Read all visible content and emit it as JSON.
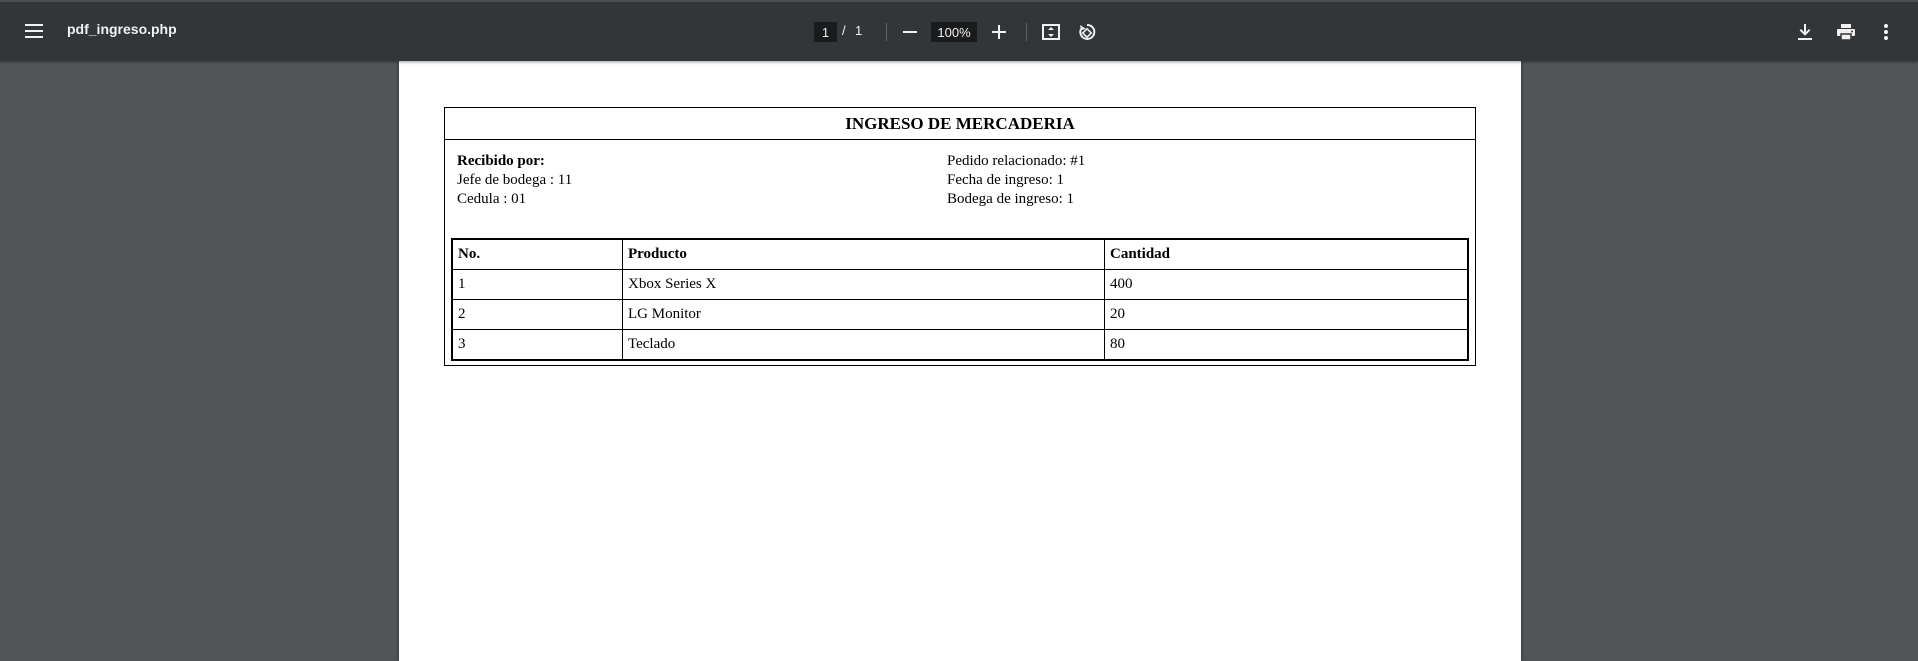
{
  "toolbar": {
    "title": "pdf_ingreso.php",
    "current_page": "1",
    "page_separator": "/",
    "total_pages": "1",
    "zoom": "100%",
    "icons": {
      "menu": "menu-icon",
      "zoom_out": "minus-icon",
      "zoom_in": "plus-icon",
      "fit": "fit-page-icon",
      "rotate": "rotate-icon",
      "download": "download-icon",
      "print": "print-icon",
      "more": "more-vert-icon"
    }
  },
  "document": {
    "heading": "INGRESO DE MERCADERIA",
    "received_by_label": "Recibido por:",
    "warehouse_chief": "Jefe de bodega : 11",
    "cedula": "Cedula : 01",
    "related_order": "Pedido relacionado: #1",
    "entry_date": "Fecha de ingreso: 1",
    "warehouse": "Bodega de ingreso: 1",
    "table": {
      "headers": [
        "No.",
        "Producto",
        "Cantidad"
      ],
      "rows": [
        [
          "1",
          "Xbox Series X",
          "400"
        ],
        [
          "2",
          "LG Monitor",
          "20"
        ],
        [
          "3",
          "Teclado",
          "80"
        ]
      ]
    }
  },
  "colors": {
    "toolbar_bg": "#323639",
    "viewer_bg": "#525659",
    "page_bg": "#ffffff",
    "input_bg": "#191b1c"
  }
}
